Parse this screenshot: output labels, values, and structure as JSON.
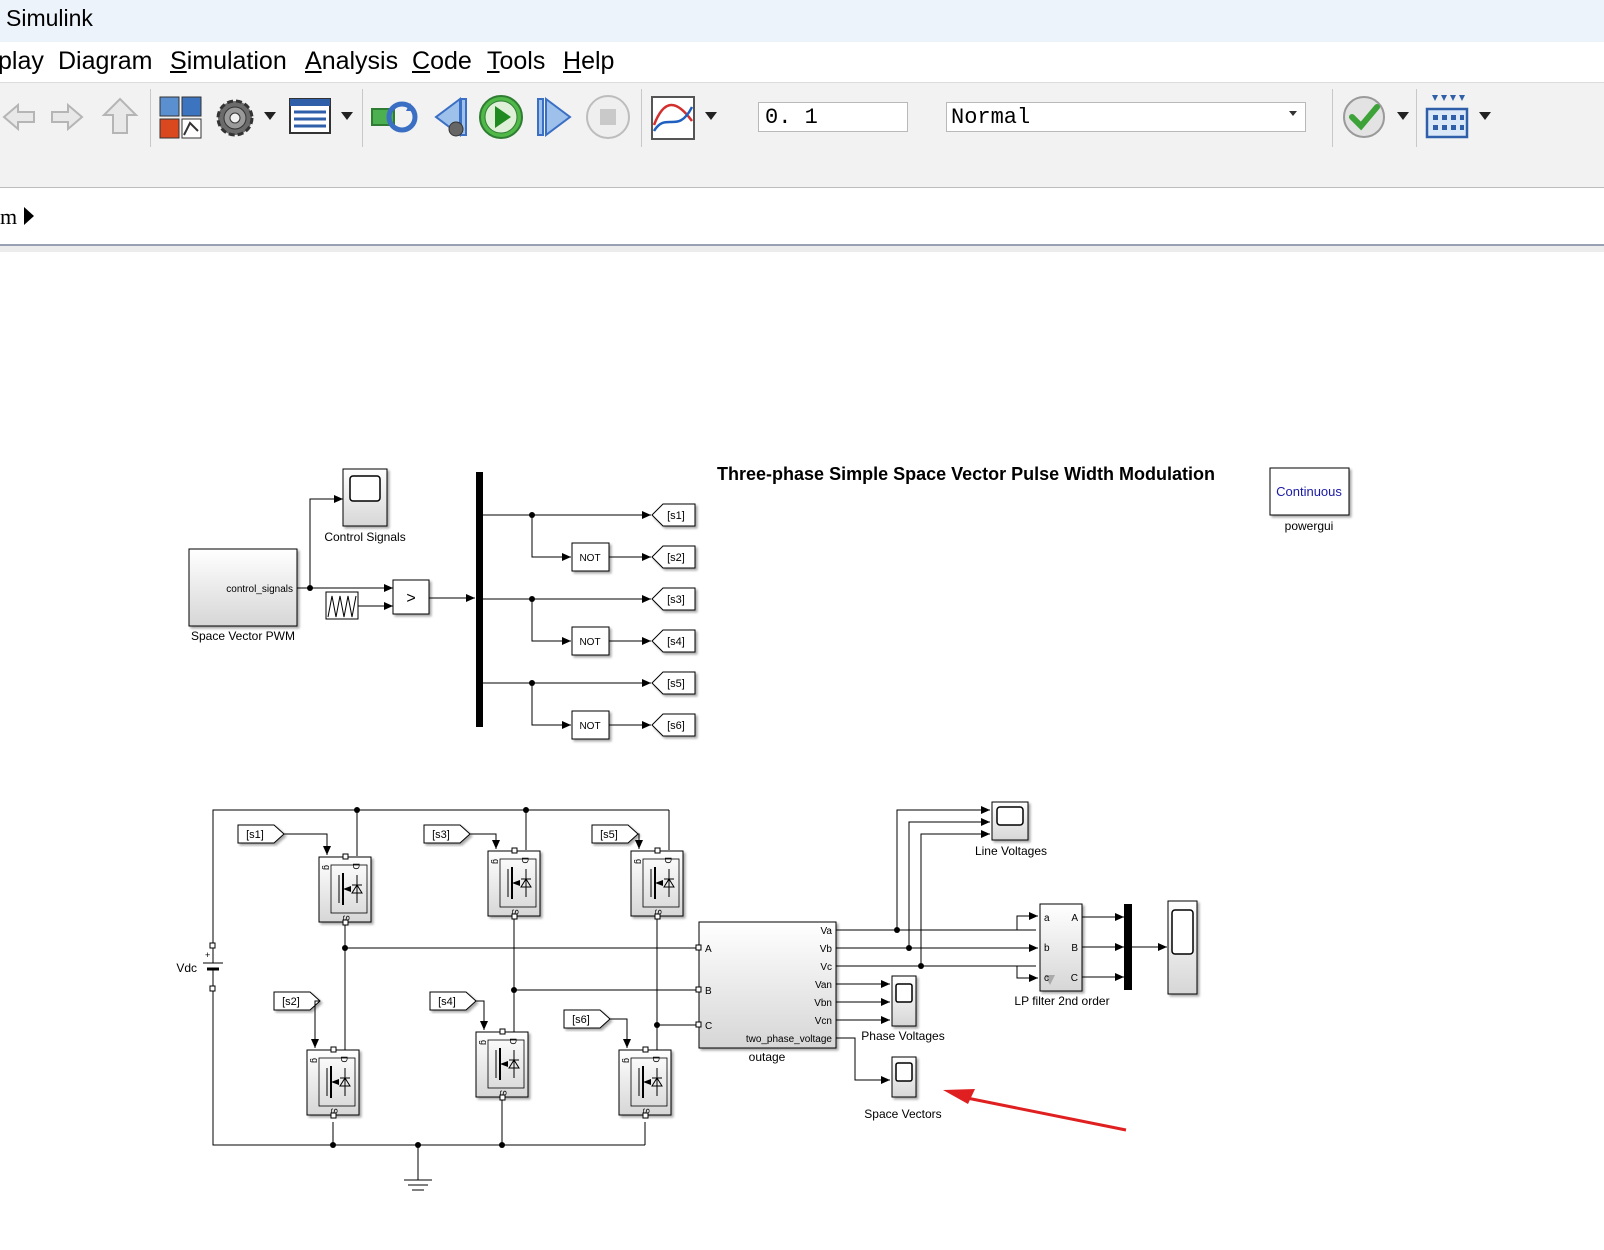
{
  "window": {
    "title": "Simulink"
  },
  "menu": [
    "play",
    "Diagram",
    "Simulation",
    "Analysis",
    "Code",
    "Tools",
    "Help"
  ],
  "menu_underline": [
    "",
    "g",
    "S",
    "A",
    "C",
    "T",
    "H"
  ],
  "toolbar": {
    "stop_time": "0. 1",
    "sim_mode": "Normal",
    "icons": [
      "back-icon",
      "forward-icon",
      "up-icon",
      "library-browser-icon",
      "model-settings-icon",
      "model-explorer-icon",
      "update-diagram-icon",
      "step-back-icon",
      "run-icon",
      "step-forward-icon",
      "stop-icon",
      "data-inspector-icon",
      "model-advisor-icon",
      "signal-builder-icon"
    ]
  },
  "breadcrumb": {
    "text": "m"
  },
  "diagram": {
    "title": "Three-phase Simple Space Vector Pulse Width Modulation",
    "powergui": {
      "button": "Continuous",
      "label": "powergui"
    },
    "svpwm": {
      "label": "Space Vector PWM",
      "port": "control_signals"
    },
    "control_scope": "Control Signals",
    "relational_op": ">",
    "not_label": "NOT",
    "goto_tags": [
      "[s1]",
      "[s2]",
      "[s3]",
      "[s4]",
      "[s5]",
      "[s6]"
    ],
    "dc_source": "Vdc",
    "mosfet_ports": {
      "g": "g",
      "d": "D",
      "s": "S"
    },
    "measurement": {
      "label": "outage",
      "inputs": [
        "A",
        "B",
        "C"
      ],
      "outputs": [
        "Va",
        "Vb",
        "Vc",
        "Van",
        "Vbn",
        "Vcn",
        "two_phase_voltage"
      ]
    },
    "line_scope": "Line Voltages",
    "phase_scope": "Phase Voltages",
    "space_scope": "Space Vectors",
    "filter": {
      "label": "LP filter 2nd order",
      "inputs": [
        "a",
        "b",
        "c"
      ],
      "outputs": [
        "A",
        "B",
        "C"
      ]
    },
    "colors": {
      "annotation_arrow": "#e02020",
      "powergui_text": "#1a1aa6",
      "highlight_bg": "#edf3fa"
    }
  }
}
